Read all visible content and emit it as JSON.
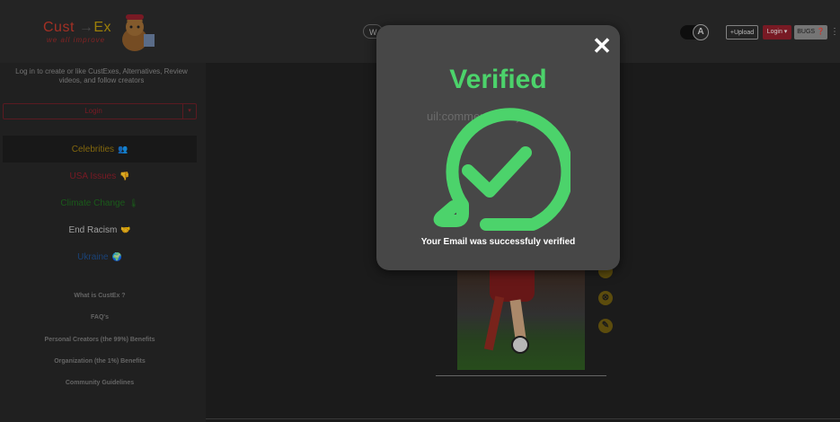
{
  "header": {
    "logo_cust": "Cust",
    "logo_arrow": "→",
    "logo_ex": "Ex",
    "logo_tagline": "we all improve",
    "search_partial": "W",
    "theme_toggle_letter": "A",
    "upload_label": "+Upload",
    "login_label": "Login ▾",
    "bugs_label": "BUGS ❓",
    "more_label": "⋮"
  },
  "sidebar": {
    "intro": "Log in to create or like CustExes, Alternatives, Review videos, and follow creators",
    "login_button": "Login",
    "login_caret": "▾",
    "categories": [
      {
        "label": "Celebrities",
        "icon": "👥",
        "color": "#9a7a10"
      },
      {
        "label": "USA Issues",
        "icon": "👎",
        "color": "#8e1f2b"
      },
      {
        "label": "Climate Change",
        "icon": "🌡",
        "color": "#1f6b1f"
      },
      {
        "label": "End Racism",
        "icon": "🤝",
        "color": "#bdbdbd"
      },
      {
        "label": "Ukraine",
        "icon": "🌍",
        "color": "#1f4f8e"
      }
    ],
    "links": [
      "What is CustEx ?",
      "FAQ's",
      "Personal Creators (the 99%) Benefits",
      "Organization (the 1%) Benefits",
      "Community Guidelines"
    ]
  },
  "card": {
    "side_icons": [
      "",
      "⊗",
      "✎"
    ]
  },
  "modal": {
    "close_label": "✕",
    "title": "Verified",
    "icon_alt": "uil:comment-verify",
    "message": "Your Email was successfuly verified",
    "accent_color": "#4cd36b"
  }
}
